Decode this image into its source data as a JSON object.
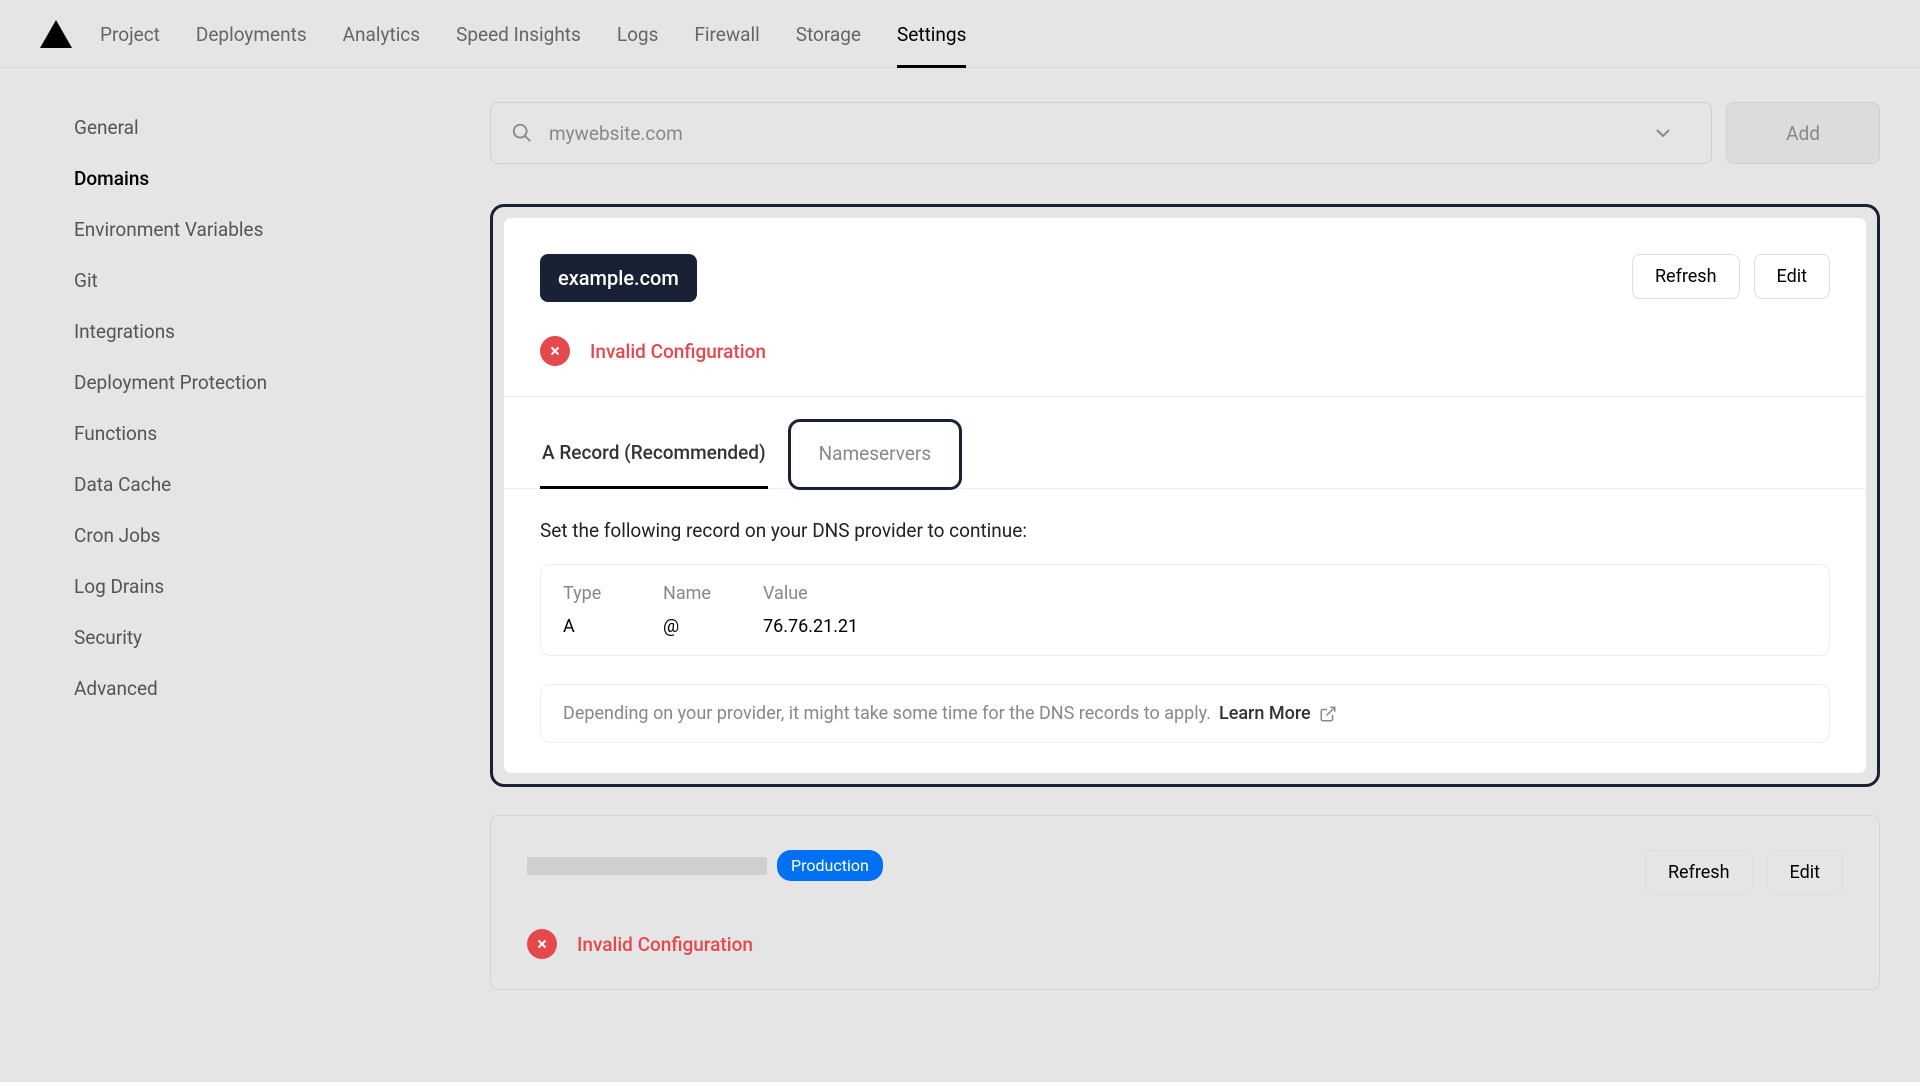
{
  "nav": {
    "tabs": [
      "Project",
      "Deployments",
      "Analytics",
      "Speed Insights",
      "Logs",
      "Firewall",
      "Storage",
      "Settings"
    ],
    "active_index": 7
  },
  "sidebar": {
    "items": [
      "General",
      "Domains",
      "Environment Variables",
      "Git",
      "Integrations",
      "Deployment Protection",
      "Functions",
      "Data Cache",
      "Cron Jobs",
      "Log Drains",
      "Security",
      "Advanced"
    ],
    "active_index": 1
  },
  "add_bar": {
    "placeholder": "mywebsite.com",
    "add_label": "Add"
  },
  "domain_card": {
    "domain": "example.com",
    "refresh_label": "Refresh",
    "edit_label": "Edit",
    "status": "Invalid Configuration",
    "tabs": {
      "a_record": "A Record (Recommended)",
      "nameservers": "Nameservers"
    },
    "desc": "Set the following record on your DNS provider to continue:",
    "dns": {
      "headers": {
        "type": "Type",
        "name": "Name",
        "value": "Value"
      },
      "values": {
        "type": "A",
        "name": "@",
        "value": "76.76.21.21"
      }
    },
    "info": "Depending on your provider, it might take some time for the DNS records to apply.",
    "learn_more": "Learn More"
  },
  "second_card": {
    "prod_label": "Production",
    "refresh_label": "Refresh",
    "edit_label": "Edit",
    "status": "Invalid Configuration"
  }
}
